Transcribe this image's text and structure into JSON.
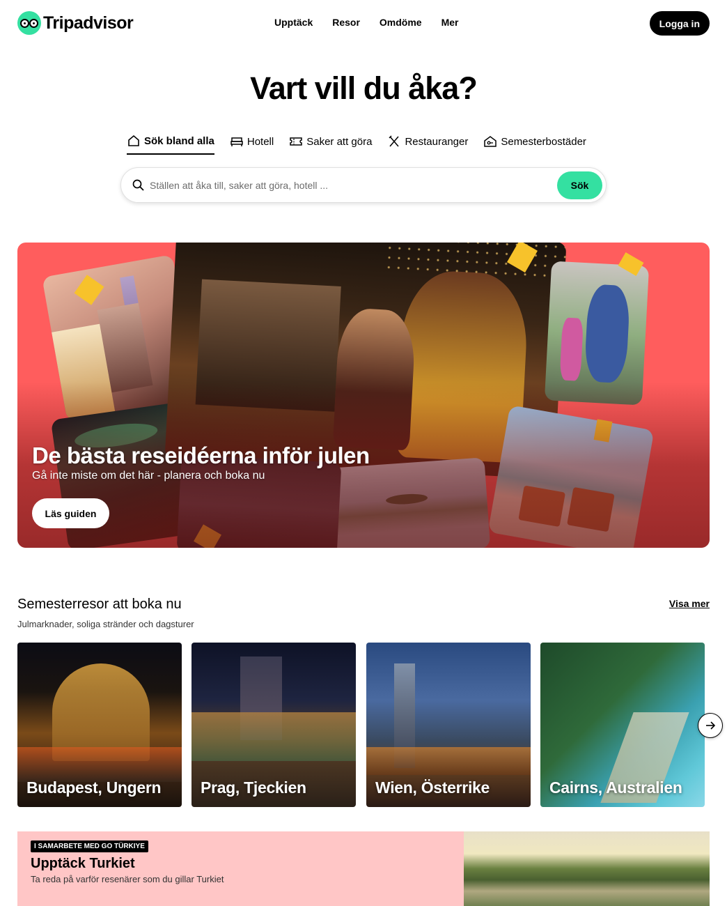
{
  "header": {
    "logo_text": "Tripadvisor",
    "nav": [
      "Upptäck",
      "Resor",
      "Omdöme",
      "Mer"
    ],
    "login_label": "Logga in"
  },
  "hero": {
    "title": "Vart vill du åka?",
    "tabs": [
      {
        "label": "Sök bland alla",
        "icon": "home-icon",
        "active": true
      },
      {
        "label": "Hotell",
        "icon": "bed-icon",
        "active": false
      },
      {
        "label": "Saker att göra",
        "icon": "ticket-icon",
        "active": false
      },
      {
        "label": "Restauranger",
        "icon": "utensils-icon",
        "active": false
      },
      {
        "label": "Semesterbostäder",
        "icon": "house-key-icon",
        "active": false
      }
    ],
    "search_placeholder": "Ställen att åka till, saker att göra, hotell ...",
    "search_button": "Sök"
  },
  "promo": {
    "title": "De bästa reseidéerna inför julen",
    "subtitle": "Gå inte miste om det här - planera och boka nu",
    "button": "Läs guiden",
    "background_color": "#ff5d5d"
  },
  "section": {
    "title": "Semesterresor att boka nu",
    "subtitle": "Julmarknader, soliga stränder och dagsturer",
    "see_more": "Visa mer",
    "cards": [
      {
        "label": "Budapest, Ungern"
      },
      {
        "label": "Prag, Tjeckien"
      },
      {
        "label": "Wien, Österrike"
      },
      {
        "label": "Cairns, Australien"
      }
    ]
  },
  "sponsor": {
    "badge": "I SAMARBETE MED GO TÜRKIYE",
    "title": "Upptäck Turkiet",
    "subtitle": "Ta reda på varför resenärer som du gillar Turkiet"
  },
  "colors": {
    "brand": "#34e0a1",
    "sponsor_bg": "#ffc6c6"
  }
}
